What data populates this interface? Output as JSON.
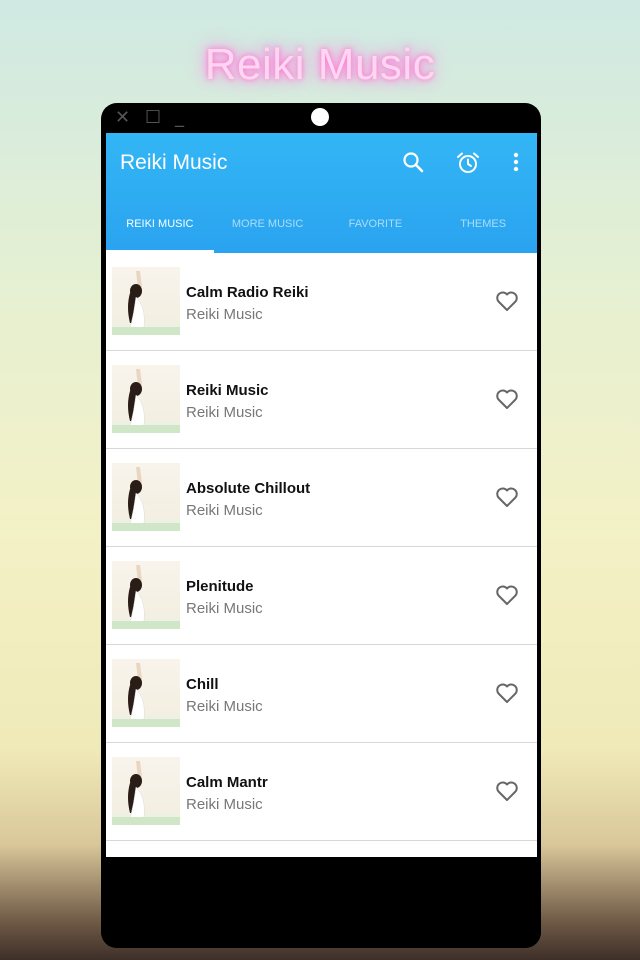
{
  "headline": "Reiki Music",
  "app": {
    "title": "Reiki Music",
    "actions": {
      "search": "search-icon",
      "alarm": "alarm-clock-icon",
      "more": "more-vert-icon"
    }
  },
  "tabs": [
    {
      "label": "REIKI MUSIC",
      "active": true
    },
    {
      "label": "MORE MUSIC",
      "active": false
    },
    {
      "label": "FAVORITE",
      "active": false
    },
    {
      "label": "THEMES",
      "active": false
    }
  ],
  "stations": [
    {
      "title": "Calm Radio Reiki",
      "subtitle": "Reiki Music"
    },
    {
      "title": "Reiki Music",
      "subtitle": "Reiki Music"
    },
    {
      "title": "Absolute Chillout",
      "subtitle": "Reiki Music"
    },
    {
      "title": "Plenitude",
      "subtitle": "Reiki Music"
    },
    {
      "title": "Chill",
      "subtitle": "Reiki Music"
    },
    {
      "title": "Calm Mantr",
      "subtitle": "Reiki Music"
    }
  ],
  "colors": {
    "appbar": "#2aa3f0",
    "headline_glow": "#ff6fd0"
  }
}
